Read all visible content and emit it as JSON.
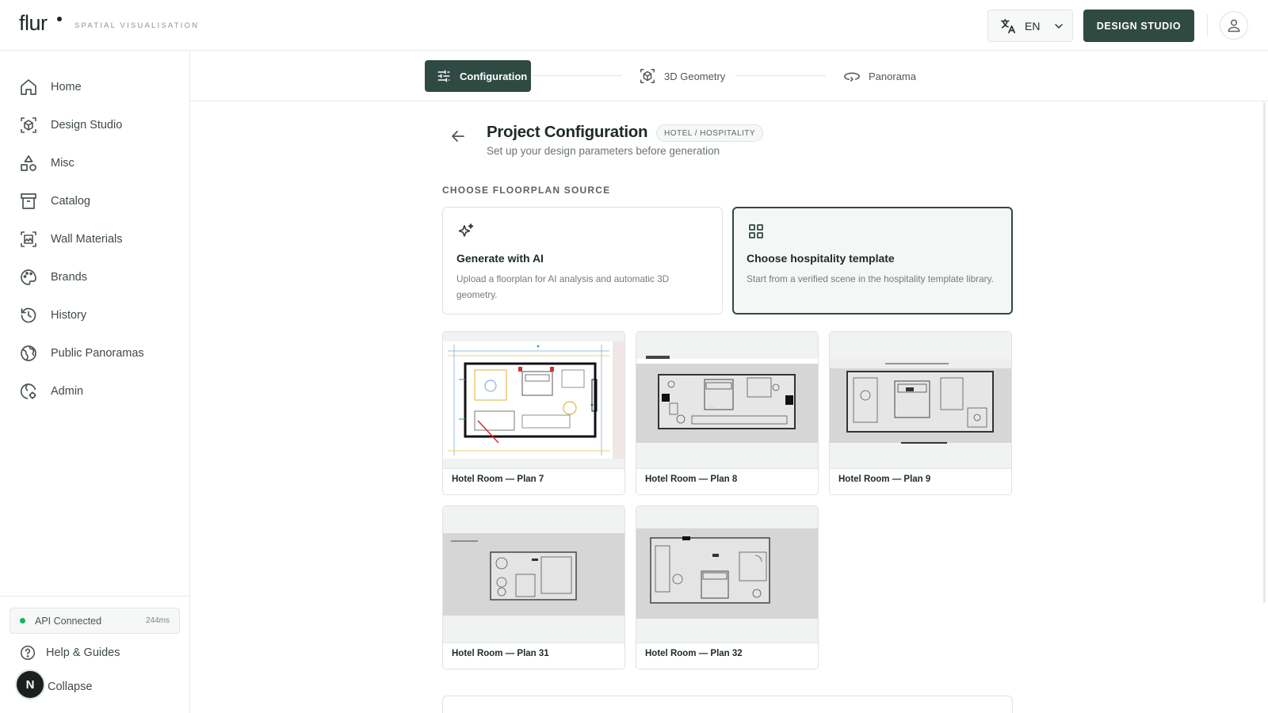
{
  "header": {
    "logo": "flur",
    "tagline": "SPATIAL VISUALISATION",
    "language": "EN",
    "studio_button": "DESIGN STUDIO"
  },
  "sidebar": {
    "items": [
      {
        "label": "Home",
        "icon": "home-icon"
      },
      {
        "label": "Design Studio",
        "icon": "cube-icon"
      },
      {
        "label": "Misc",
        "icon": "shapes-icon"
      },
      {
        "label": "Catalog",
        "icon": "archive-icon"
      },
      {
        "label": "Wall Materials",
        "icon": "image-frame-icon"
      },
      {
        "label": "Brands",
        "icon": "palette-icon"
      },
      {
        "label": "History",
        "icon": "history-icon"
      },
      {
        "label": "Public Panoramas",
        "icon": "globe-icon"
      },
      {
        "label": "Admin",
        "icon": "admin-gear-icon"
      }
    ],
    "api_status": "API Connected",
    "api_latency": "244ms",
    "help": "Help & Guides",
    "collapse": "Collapse",
    "user_initial": "N"
  },
  "stepper": {
    "steps": [
      "Configuration",
      "3D Geometry",
      "Panorama"
    ],
    "active": 0
  },
  "main": {
    "title": "Project Configuration",
    "badge": "HOTEL / HOSPITALITY",
    "subtitle": "Set up your design parameters before generation",
    "section_label": "CHOOSE FLOORPLAN SOURCE",
    "sources": [
      {
        "title": "Generate with AI",
        "desc": "Upload a floorplan for AI analysis and automatic 3D geometry.",
        "selected": false,
        "icon": "sparkles-icon"
      },
      {
        "title": "Choose hospitality template",
        "desc": "Start from a verified scene in the hospitality template library.",
        "selected": true,
        "icon": "grid-icon"
      }
    ],
    "plans": [
      {
        "label": "Hotel Room — Plan 7"
      },
      {
        "label": "Hotel Room — Plan 8"
      },
      {
        "label": "Hotel Room — Plan 9"
      },
      {
        "label": "Hotel Room — Plan 31"
      },
      {
        "label": "Hotel Room — Plan 32"
      }
    ]
  },
  "colors": {
    "primary": "#2f4a42",
    "status_ok": "#17b26a",
    "border": "#dfe3e2"
  }
}
